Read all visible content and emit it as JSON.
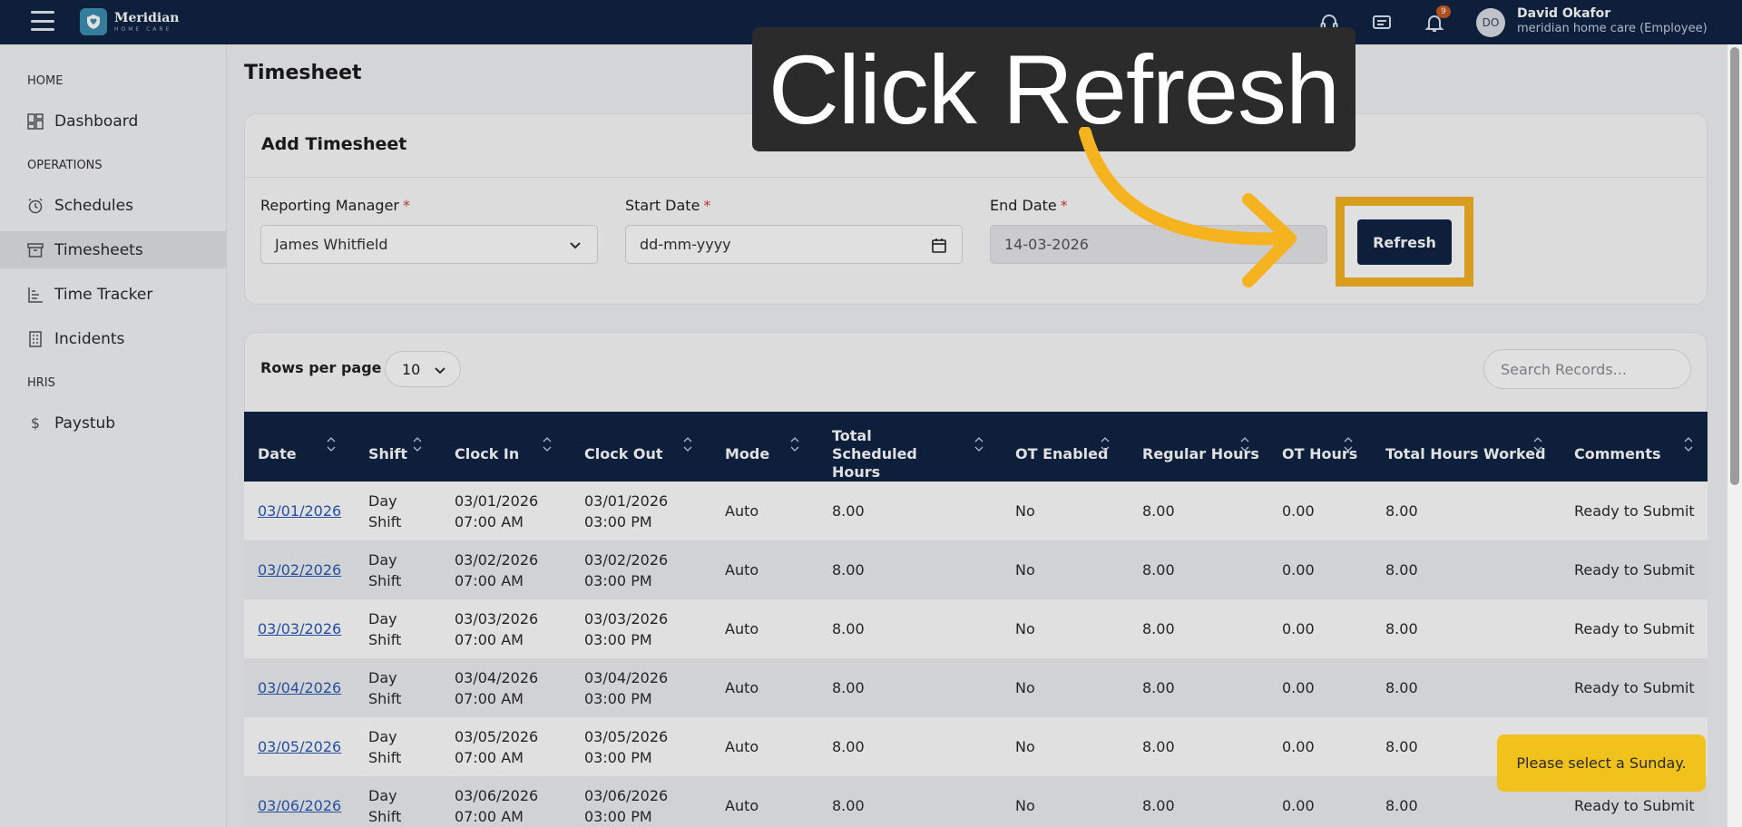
{
  "topbar": {
    "logo_name": "Meridian",
    "logo_sub": "HOME CARE",
    "notification_count": "9",
    "avatar_initials": "DO",
    "user_name": "David Okafor",
    "user_subtitle": "meridian home care (Employee)"
  },
  "sidebar": {
    "sections": [
      "HOME",
      "OPERATIONS",
      "HRIS"
    ],
    "items": [
      {
        "label": "Dashboard",
        "icon": "dashboard-icon"
      },
      {
        "label": "Schedules",
        "icon": "alarm-clock-icon"
      },
      {
        "label": "Timesheets",
        "icon": "archive-box-icon"
      },
      {
        "label": "Time Tracker",
        "icon": "bar-list-icon"
      },
      {
        "label": "Incidents",
        "icon": "building-icon"
      },
      {
        "label": "Paystub",
        "icon": "dollar-icon"
      }
    ]
  },
  "page": {
    "title": "Timesheet"
  },
  "add_timesheet": {
    "title": "Add Timesheet",
    "reporting_manager_label": "Reporting Manager",
    "reporting_manager_value": "James Whitfield",
    "start_date_label": "Start Date",
    "start_date_placeholder": "dd-mm-yyyy",
    "end_date_label": "End Date",
    "end_date_value": "14-03-2026",
    "required_mark": "*",
    "refresh_label": "Refresh"
  },
  "records": {
    "rows_per_page_label": "Rows per page",
    "rows_per_page_value": "10",
    "search_placeholder": "Search Records..."
  },
  "table": {
    "columns": [
      "Date",
      "Shift",
      "Clock In",
      "Clock Out",
      "Mode",
      "Total Scheduled Hours",
      "OT Enabled",
      "Regular Hours",
      "OT Hours",
      "Total Hours Worked",
      "Comments"
    ],
    "rows": [
      {
        "date": "03/01/2026",
        "shift_1": "Day",
        "shift_2": "Shift",
        "in_date": "03/01/2026",
        "in_time": "07:00 AM",
        "out_date": "03/01/2026",
        "out_time": "03:00 PM",
        "mode": "Auto",
        "scheduled": "8.00",
        "ot_enabled": "No",
        "regular": "8.00",
        "ot": "0.00",
        "worked": "8.00",
        "comment": "Ready to Submit"
      },
      {
        "date": "03/02/2026",
        "shift_1": "Day",
        "shift_2": "Shift",
        "in_date": "03/02/2026",
        "in_time": "07:00 AM",
        "out_date": "03/02/2026",
        "out_time": "03:00 PM",
        "mode": "Auto",
        "scheduled": "8.00",
        "ot_enabled": "No",
        "regular": "8.00",
        "ot": "0.00",
        "worked": "8.00",
        "comment": "Ready to Submit"
      },
      {
        "date": "03/03/2026",
        "shift_1": "Day",
        "shift_2": "Shift",
        "in_date": "03/03/2026",
        "in_time": "07:00 AM",
        "out_date": "03/03/2026",
        "out_time": "03:00 PM",
        "mode": "Auto",
        "scheduled": "8.00",
        "ot_enabled": "No",
        "regular": "8.00",
        "ot": "0.00",
        "worked": "8.00",
        "comment": "Ready to Submit"
      },
      {
        "date": "03/04/2026",
        "shift_1": "Day",
        "shift_2": "Shift",
        "in_date": "03/04/2026",
        "in_time": "07:00 AM",
        "out_date": "03/04/2026",
        "out_time": "03:00 PM",
        "mode": "Auto",
        "scheduled": "8.00",
        "ot_enabled": "No",
        "regular": "8.00",
        "ot": "0.00",
        "worked": "8.00",
        "comment": "Ready to Submit"
      },
      {
        "date": "03/05/2026",
        "shift_1": "Day",
        "shift_2": "Shift",
        "in_date": "03/05/2026",
        "in_time": "07:00 AM",
        "out_date": "03/05/2026",
        "out_time": "03:00 PM",
        "mode": "Auto",
        "scheduled": "8.00",
        "ot_enabled": "No",
        "regular": "8.00",
        "ot": "0.00",
        "worked": "8.00",
        "comment": ""
      },
      {
        "date": "03/06/2026",
        "shift_1": "Day",
        "shift_2": "Shift",
        "in_date": "03/06/2026",
        "in_time": "07:00 AM",
        "out_date": "03/06/2026",
        "out_time": "03:00 PM",
        "mode": "Auto",
        "scheduled": "8.00",
        "ot_enabled": "No",
        "regular": "8.00",
        "ot": "0.00",
        "worked": "8.00",
        "comment": "Ready to Submit"
      }
    ]
  },
  "tutorial": {
    "callout_text": "Click Refresh",
    "highlight_color": "#f6b320"
  },
  "toast": {
    "message": "Please select a Sunday."
  },
  "colors": {
    "brand_navy": "#0f2444",
    "link": "#2c5ab8",
    "toast": "#f1c21b"
  }
}
